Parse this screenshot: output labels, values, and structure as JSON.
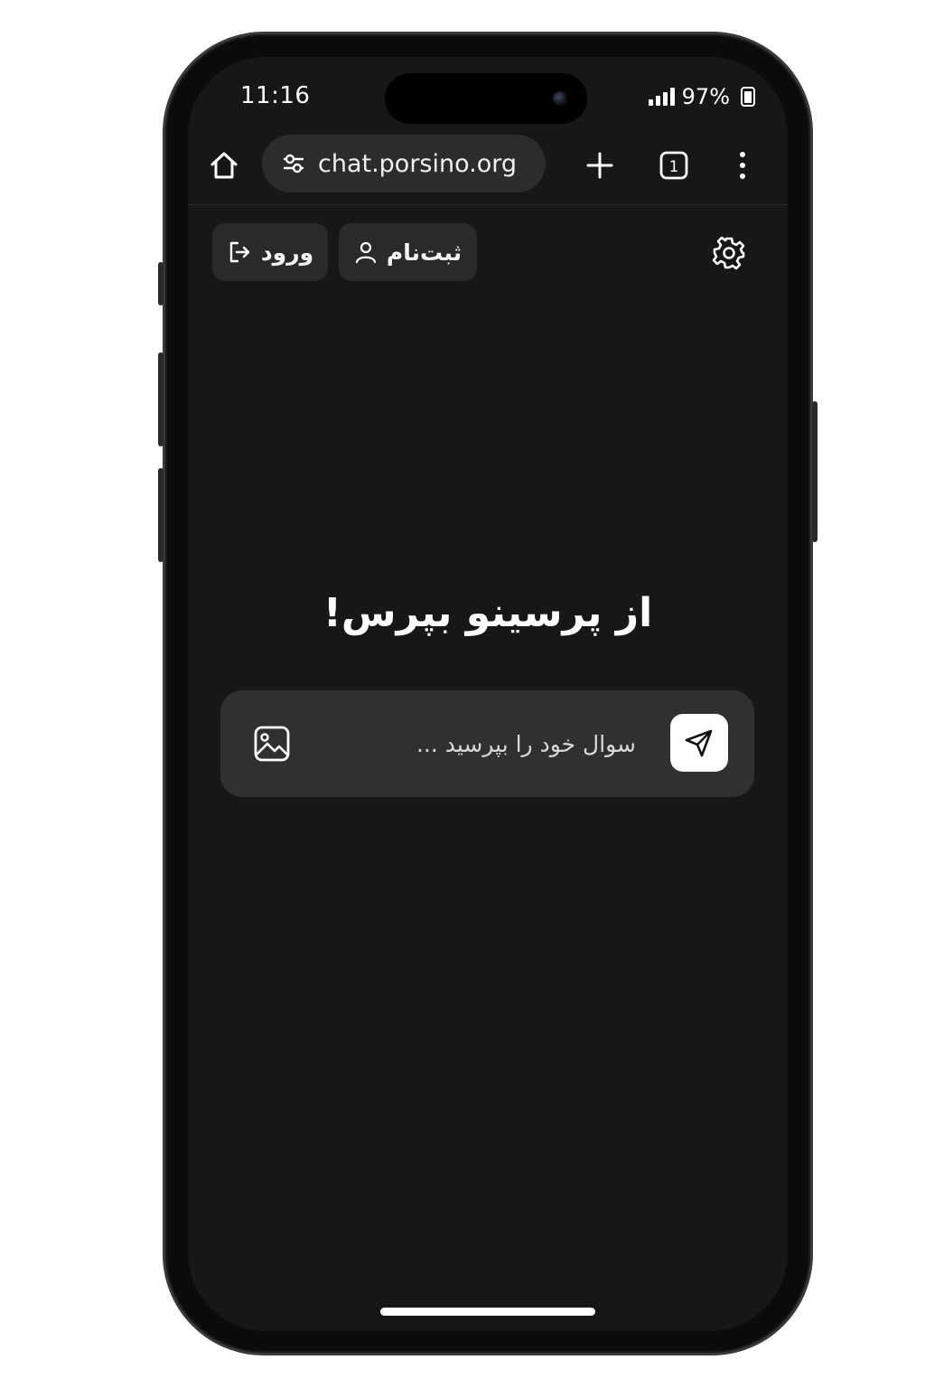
{
  "status_bar": {
    "time": "11:16",
    "battery_percent": "97%"
  },
  "browser": {
    "url": "chat.porsino.org",
    "tab_count": "1"
  },
  "header": {
    "login_label": "ورود",
    "signup_label": "ثبت‌نام"
  },
  "main": {
    "headline": "از پرسینو بپرس!",
    "input_placeholder": "سوال خود را بپرسید ..."
  },
  "colors": {
    "background": "#171717",
    "button_bg": "#2a2a2a",
    "input_bg": "#303030",
    "send_button_bg": "#ffffff"
  },
  "icons": [
    "home-icon",
    "site-settings-icon",
    "plus-icon",
    "tabs-icon",
    "menu-icon",
    "login-icon",
    "user-icon",
    "gear-icon",
    "image-icon",
    "send-icon"
  ]
}
